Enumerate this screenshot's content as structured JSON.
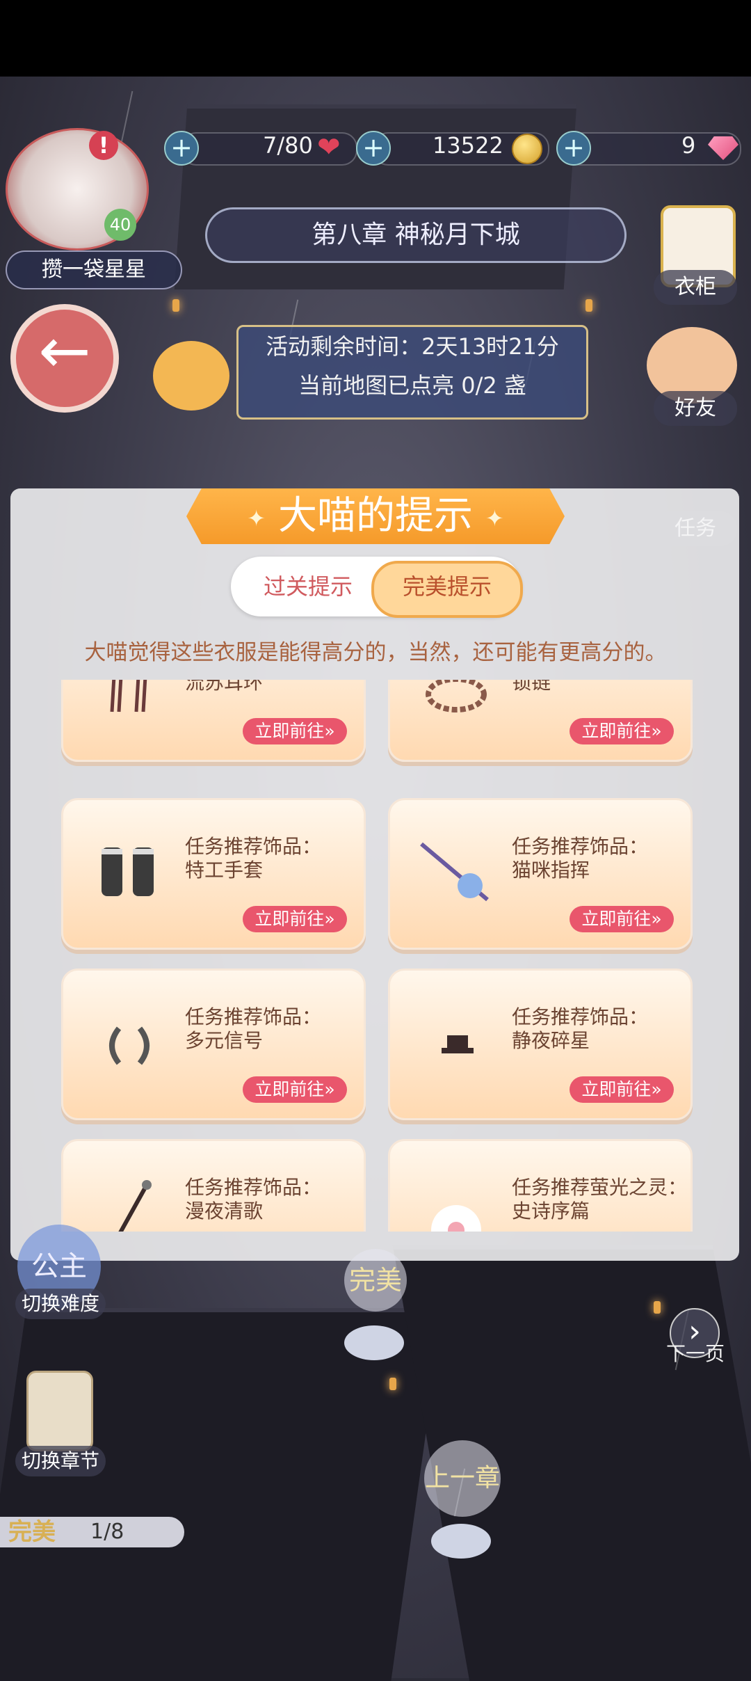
{
  "resources": {
    "stamina": "7/80",
    "coins": "13522",
    "gems": "9"
  },
  "player": {
    "avatar_badge": "40",
    "nickname": "攒一袋星星"
  },
  "chapter": {
    "title": "第八章 神秘月下城"
  },
  "event": {
    "time_left": "活动剩余时间：2天13时21分",
    "lanterns": "当前地图已点亮 0/2 盏"
  },
  "side": {
    "wardrobe": "衣柜",
    "friends": "好友",
    "tasks": "任务"
  },
  "dialog": {
    "title": "大喵的提示",
    "tabs": [
      "过关提示",
      "完美提示"
    ],
    "message": "大喵觉得这些衣服是能得高分的，当然，还可能有更高分的。",
    "go_label": "立即前往»",
    "items": [
      {
        "label": "任务推荐饰品：\n流苏耳环"
      },
      {
        "label": "任务推荐饰品：\n锁链"
      },
      {
        "label": "任务推荐饰品：\n特工手套"
      },
      {
        "label": "任务推荐饰品：\n猫咪指挥"
      },
      {
        "label": "任务推荐饰品：\n多元信号"
      },
      {
        "label": "任务推荐饰品：\n静夜碎星"
      },
      {
        "label": "任务推荐饰品：\n漫夜清歌"
      },
      {
        "label": "任务推荐萤光之灵：\n史诗序篇"
      }
    ]
  },
  "bottom": {
    "difficulty_icon": "公主",
    "switch_difficulty": "切换难度",
    "switch_chapter": "切换章节",
    "perfect_node": "完美",
    "prev_chapter": "上一章",
    "next_page": "下一页",
    "progress_label": "完美",
    "progress_value": "1/8"
  }
}
